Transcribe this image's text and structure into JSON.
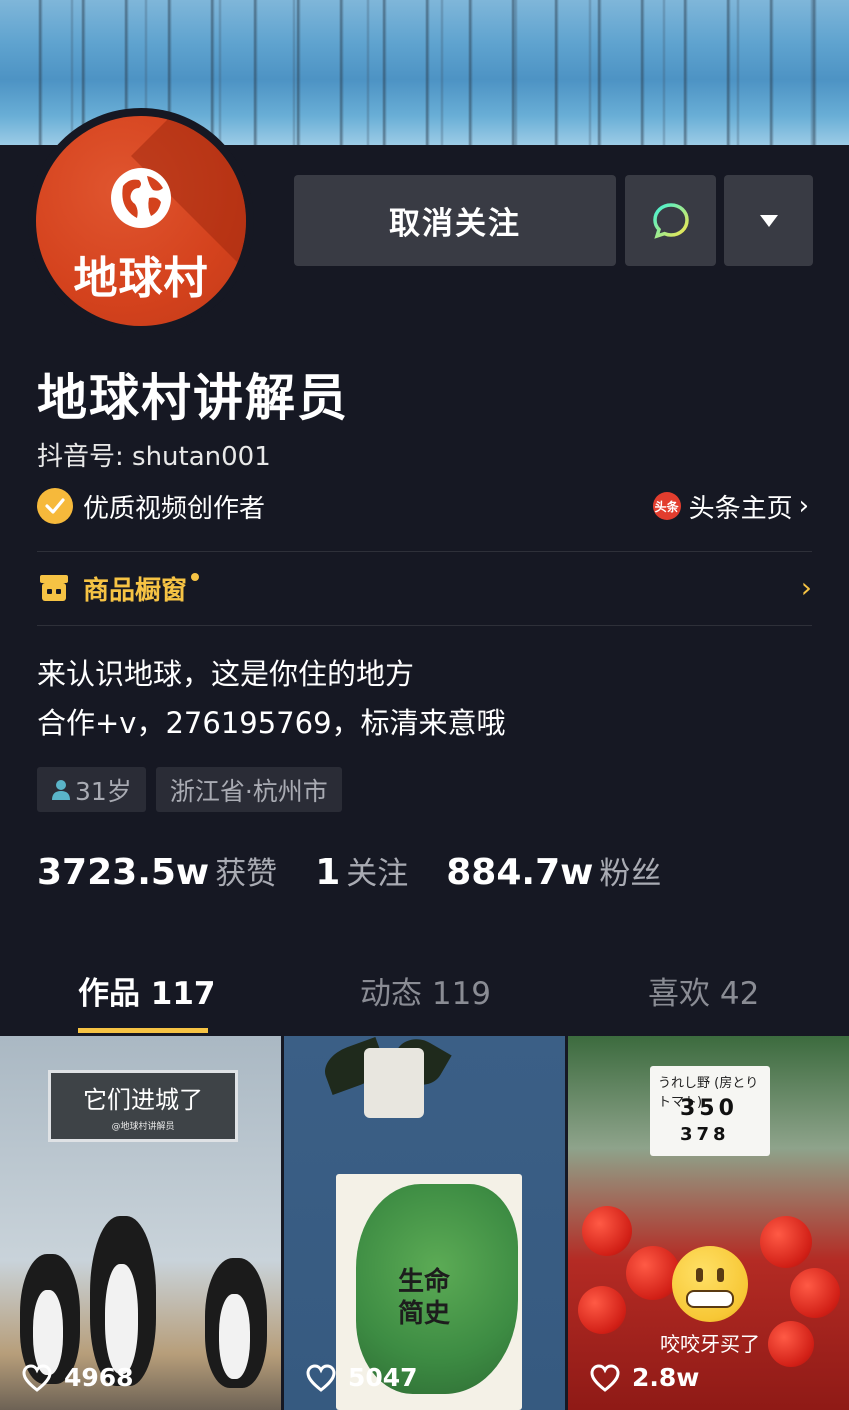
{
  "profile": {
    "avatar_text": "地球村",
    "name": "地球村讲解员",
    "douyin_id": "抖音号: shutan001",
    "badge": "优质视频创作者",
    "toutiao_logo": "头条",
    "toutiao_label": "头条主页"
  },
  "actions": {
    "unfollow_label": "取消关注",
    "message_icon": "chat-bubble-icon",
    "more_icon": "caret-down-icon"
  },
  "shop": {
    "label": "商品橱窗",
    "icon": "store-icon"
  },
  "bio": {
    "line1": "来认识地球，这是你住的地方",
    "line2": "合作+v，276195769，标清来意哦"
  },
  "tags": {
    "age": "31岁",
    "location": "浙江省·杭州市"
  },
  "stats": {
    "likes_num": "3723.5w",
    "likes_label": "获赞",
    "following_num": "1",
    "following_label": "关注",
    "fans_num": "884.7w",
    "fans_label": "粉丝"
  },
  "tabs": {
    "works": "作品 117",
    "moments": "动态 119",
    "liked": "喜欢 42"
  },
  "videos": [
    {
      "sign_title": "它们进城了",
      "sign_sub": "@地球村讲解员",
      "likes": "4968"
    },
    {
      "book_title_1": "生命",
      "book_title_2": "简史",
      "likes": "5047"
    },
    {
      "price_top": "うれし野 (房とりトマト)",
      "price_num": "350",
      "price_num2": "378",
      "caption": "咬咬牙买了",
      "likes": "2.8w"
    }
  ],
  "colors": {
    "background": "#161823",
    "button": "#393b44",
    "accent": "#f6c344",
    "muted": "#a9abb3"
  }
}
